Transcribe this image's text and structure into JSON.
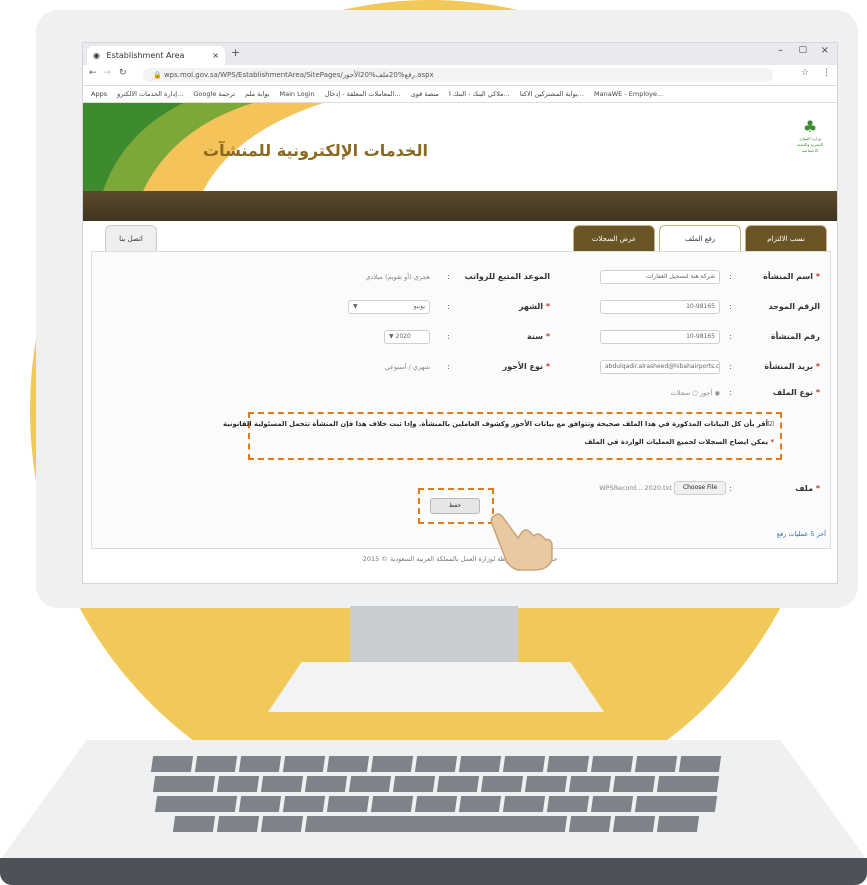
{
  "browser": {
    "tab_title": "Establishment Area",
    "url": "wps.mol.gov.sa/WPS/EstablishmentArea/SitePages/رفع%20ملف%20الأجور.aspx",
    "bookmarks": [
      "Apps",
      "إدارة الخدمات الالكترو...",
      "Google ترجمة",
      "بوابة ملم",
      "Main Login",
      "المعاملات المعلقة - إدخال...",
      "منصة قوى",
      "ملاكي البنك - البنك ا...",
      "بوابة المشتركين الاكتا...",
      "ManaWE - Employe..."
    ]
  },
  "site": {
    "title": "الخدمات الإلكترونية للمنشآت",
    "ministry": "وزارة الموارد البشرية والتنمية الاجتماعية"
  },
  "tabs": [
    "نسب الالتزام",
    "رفع الملف",
    "عرض السجلات",
    "اتصل بنا"
  ],
  "form": {
    "fields": [
      {
        "label": "اسم المنشأة",
        "required": true,
        "value": "شركة هبة لتسجيل العقارات"
      },
      {
        "label": "الرقم الموحد",
        "required": false,
        "value": "10-98165"
      },
      {
        "label": "رقم المنشأة",
        "required": false,
        "value": "10-98165"
      },
      {
        "label": "بريد المنشأة",
        "required": true,
        "value": "abdulqadir.alrasheed@hibahairports.com"
      },
      {
        "label": "نوع الملف",
        "required": true,
        "value": "أجور"
      },
      {
        "label": "ملف",
        "required": true,
        "value": "WPSRecord... 2020.txt"
      }
    ],
    "right_fields": [
      {
        "label": "الموعد المتبع للرواتب",
        "required": false,
        "value": "هجري (أو تقويم) ميلادي"
      },
      {
        "label": "الشهر",
        "required": true,
        "value": "يونيو"
      },
      {
        "label": "سنة",
        "required": true,
        "value": "2020"
      },
      {
        "label": "نوع الأجور",
        "required": true,
        "value": "شهري / أسبوعي"
      }
    ],
    "choose_file": "Choose File",
    "file_type_option": "سجلات",
    "confirm_1": "أقر بأن كل البيانات المذكورة في هذا الملف صحيحة وتتوافق مع بيانات الأجور وكشوف العاملين بالمنشأة. وإذا ثبت خلاف هذا فإن المنشأة تتحمل المسئولية القانونية",
    "confirm_2": "يمكن ايضاح السجلات لجميع العمليات الواردة في الملف",
    "save": "حفظ",
    "recent_link": "آخر 5 عمليات رفع"
  },
  "footer": "جميع الحقوق محفوظة لوزارة العمل بالمملكة العربية السعودية © 2015",
  "colors": {
    "accent_orange": "#e07a1c",
    "background_yellow": "#f0c95a",
    "brand_brown": "#6a5526",
    "brand_green": "#3d8a2f"
  }
}
